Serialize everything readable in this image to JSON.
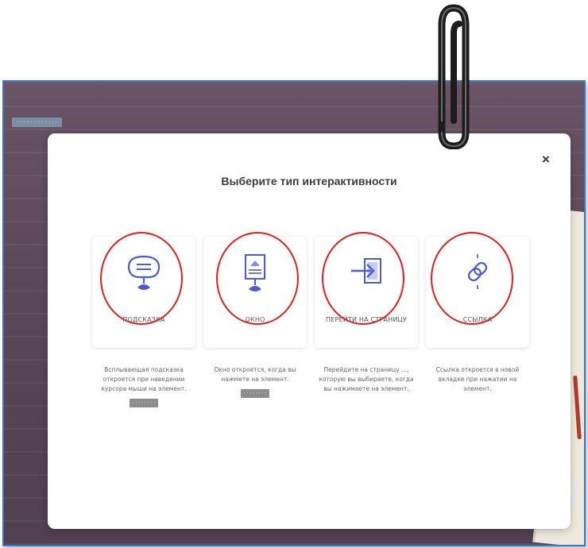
{
  "background": {
    "tag_label": "· · · · · · · · · · · ·"
  },
  "modal": {
    "title": "Выберите тип интерактивности",
    "close_symbol": "×"
  },
  "options": [
    {
      "label": "ПОДСКАЗКА",
      "description": "Всплывающая подсказка откроется при наведении курсора мыши на элемент.",
      "button": "· · · · · · · ·",
      "icon": "tooltip-icon"
    },
    {
      "label": "ОКНО",
      "description": "Окно откроется, когда вы нажмете на элемент.",
      "button": "· · · · · · · ·",
      "icon": "window-icon"
    },
    {
      "label": "ПЕРЕЙТИ НА СТРАНИЦУ",
      "description": "Перейдите на страницу ..., которую вы выбираете, когда вы нажимаете на элемент.",
      "icon": "goto-page-icon"
    },
    {
      "label": "ССЫЛКА",
      "description": "Ссылка откроется в новой вкладке при нажатии на элемент.",
      "icon": "link-icon"
    }
  ],
  "colors": {
    "accent": "#4c5bd4",
    "annotation": "#e02020",
    "frame_border": "#3b78c4"
  }
}
